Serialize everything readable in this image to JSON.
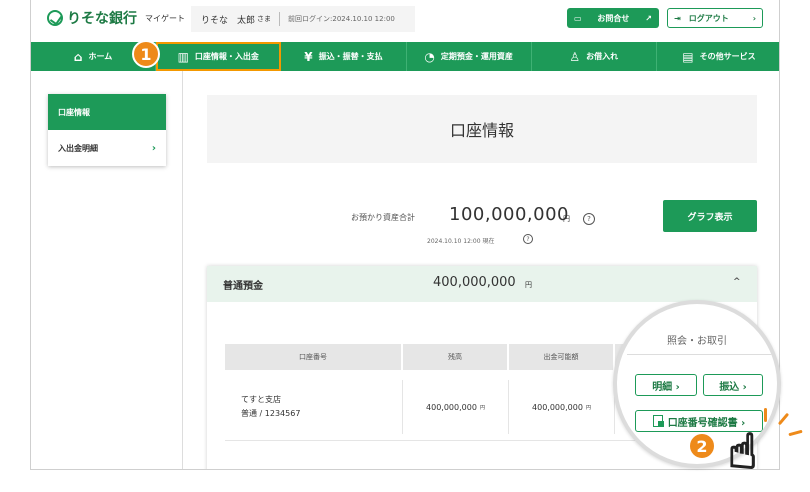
{
  "header": {
    "logo": "りそな銀行",
    "logo_sub": "マイゲート",
    "user_name": "りそな　太郎",
    "user_honorific": "さま",
    "last_login": "前回ログイン:2024.10.10 12:00",
    "inquiry_label": "お問合せ",
    "logout_label": "ログアウト"
  },
  "nav": {
    "items": [
      {
        "label": "ホーム",
        "icon": "⌂"
      },
      {
        "label": "口座情報・入出金",
        "icon": "▥"
      },
      {
        "label": "振込・振替・支払",
        "icon": "¥"
      },
      {
        "label": "定期預金・運用資産",
        "icon": "◔"
      },
      {
        "label": "お借入れ",
        "icon": "♙"
      },
      {
        "label": "その他サービス",
        "icon": "▤"
      }
    ]
  },
  "sidebar": {
    "items": [
      {
        "label": "口座情報"
      },
      {
        "label": "入出金明細",
        "chevron": "›"
      }
    ]
  },
  "main": {
    "title": "口座情報",
    "total_label": "お預かり資産合計",
    "total_value": "100,000,000",
    "total_unit": "円",
    "as_of": "2024.10.10 12:00 現在",
    "graph_button": "グラフ表示",
    "help": "?"
  },
  "account": {
    "type": "普通預金",
    "amount": "400,000,000",
    "unit": "円",
    "caret": "^",
    "columns": [
      "口座番号",
      "残高",
      "出金可能額",
      ""
    ],
    "row": {
      "branch": "てすと支店",
      "number": "普通 / 1234567",
      "balance": "400,000,000",
      "available": "400,000,000",
      "unit": "円"
    }
  },
  "magnifier": {
    "title": "照会・お取引",
    "btn_statement": "明細 ›",
    "btn_transfer": "振込 ›",
    "btn_certificate": "口座番号確認書 ›"
  },
  "steps": {
    "one": "1",
    "two": "2"
  },
  "icons": {
    "inquiry": "chat-icon",
    "external": "external-link-icon",
    "logout": "logout-icon"
  }
}
